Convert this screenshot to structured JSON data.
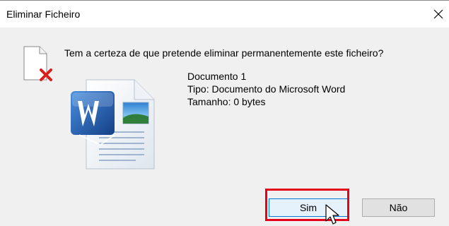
{
  "window": {
    "title": "Eliminar Ficheiro",
    "close_glyph": "✕"
  },
  "message": {
    "question": "Tem a certeza de que pretende eliminar permanentemente este ficheiro?"
  },
  "file": {
    "name": "Documento 1",
    "type": "Tipo: Documento do Microsoft Word",
    "size": "Tamanho: 0 bytes"
  },
  "buttons": {
    "yes_label": "Sim",
    "no_label": "Não"
  },
  "colors": {
    "highlight": "#e5001c",
    "default_button_border": "#0078d7",
    "word_blue": "#1e5aa8"
  },
  "icons": {
    "file_delete": "file-delete-icon",
    "word_document": "word-document-icon",
    "close": "close-icon",
    "cursor": "mouse-pointer-icon"
  }
}
